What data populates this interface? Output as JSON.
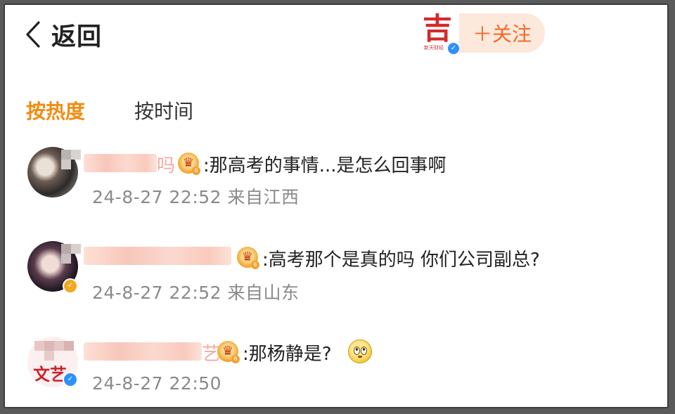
{
  "header": {
    "back_label": "返回",
    "follow_label": "＋关注",
    "logo_glyph": "吉",
    "logo_caption": "新天财经"
  },
  "tabs": [
    {
      "label": "按热度",
      "active": true
    },
    {
      "label": "按时间",
      "active": false
    }
  ],
  "comments": [
    {
      "name_tail": "吗",
      "text": ":那高考的事情...是怎么回事啊",
      "meta": "24-8-27 22:52 来自江西",
      "vip_level": "6"
    },
    {
      "name_tail": "",
      "text": ":高考那个是真的吗 你们公司副总?",
      "meta": "24-8-27 22:52 来自山东",
      "vip_level": "6",
      "verified": true
    },
    {
      "name_tail": "艺",
      "text": ":那杨静是?",
      "meta": "24-8-27 22:50",
      "vip_level": "6",
      "verified": true,
      "emoji": "thinking-face-icon",
      "avatar_text": "文艺"
    }
  ],
  "colors": {
    "active_tab": "#f28b12",
    "follow_text": "#f26a2a",
    "follow_bg": "#fde8dc",
    "verified": "#2e90ff",
    "meta": "#8a8a8a"
  }
}
